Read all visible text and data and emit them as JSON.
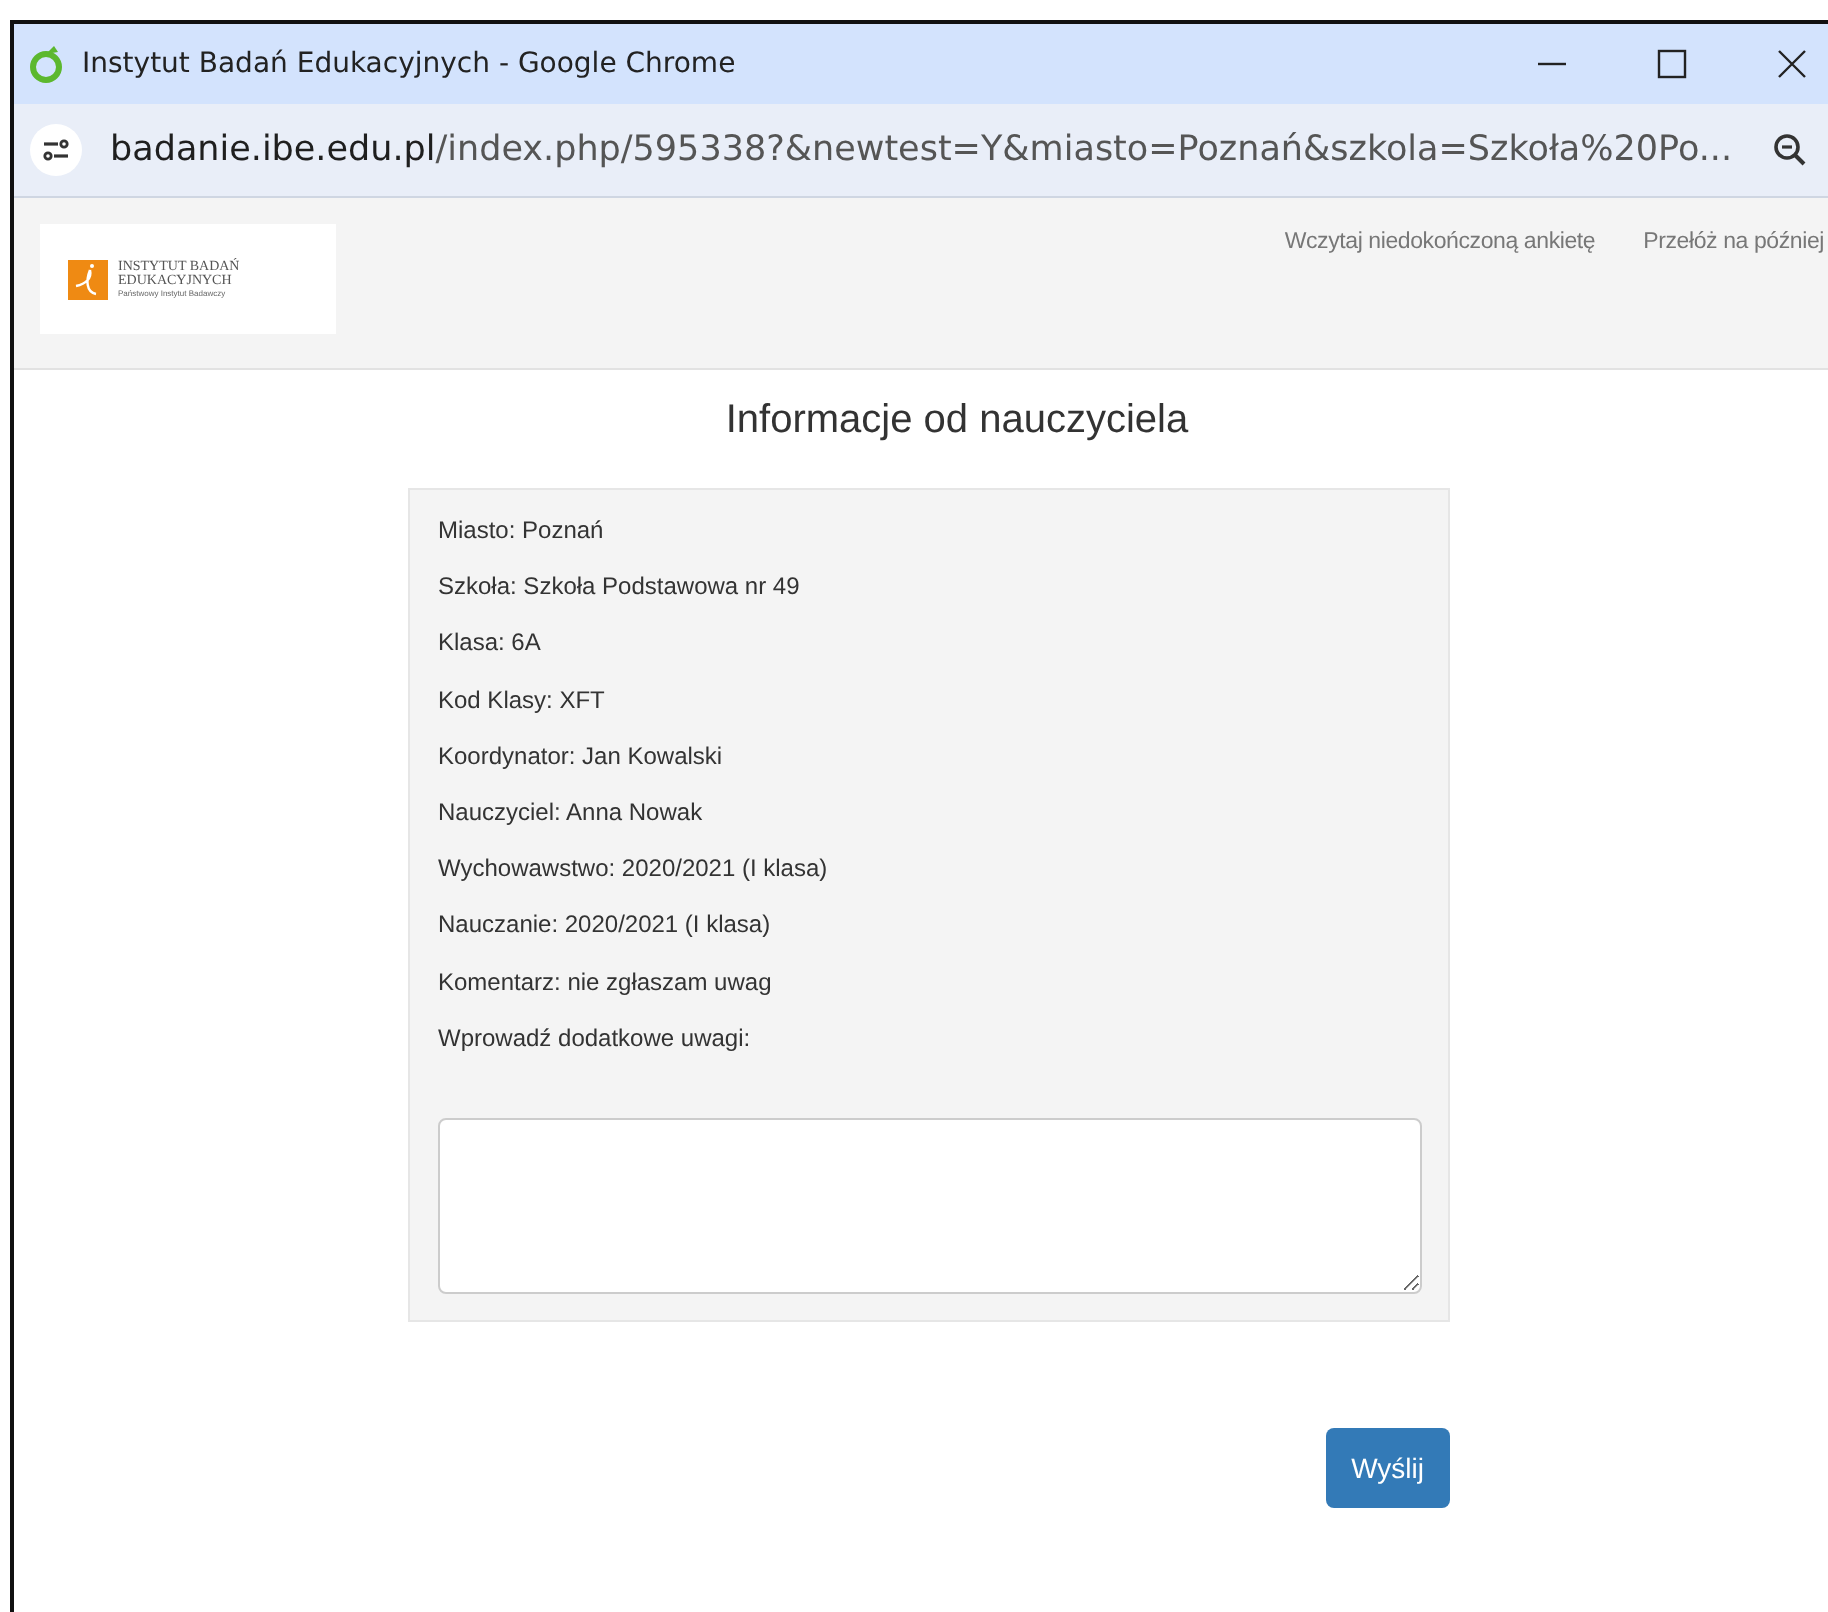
{
  "window": {
    "title": "Instytut Badań Edukacyjnych - Google Chrome",
    "address": {
      "host": "badanie.ibe.edu.pl",
      "path": "/index.php/595338?&newtest=Y&miasto=Poznań&szkola=Szkoła%20Po..."
    }
  },
  "header": {
    "logo": {
      "line_1": "INSTYTUT BADAŃ",
      "line_2": "EDUKACYJNYCH",
      "line_3": "Państwowy Instytut Badawczy"
    },
    "links": [
      "Wczytaj niedokończoną ankietę",
      "Przełóż na później"
    ]
  },
  "heading": "Informacje od nauczyciela",
  "info_lines": [
    "Miasto: Poznań",
    "Szkoła: Szkoła Podstawowa nr 49",
    "Klasa: 6A",
    "Kod Klasy: XFT",
    "Koordynator: Jan Kowalski",
    "Nauczyciel: Anna Nowak",
    "Wychowawstwo: 2020/2021 (I klasa)",
    "Nauczanie: 2020/2021 (I klasa)",
    "Komentarz: nie zgłaszam uwag",
    "Wprowadź dodatkowe uwagi:"
  ],
  "submit_button": "Wyślij"
}
